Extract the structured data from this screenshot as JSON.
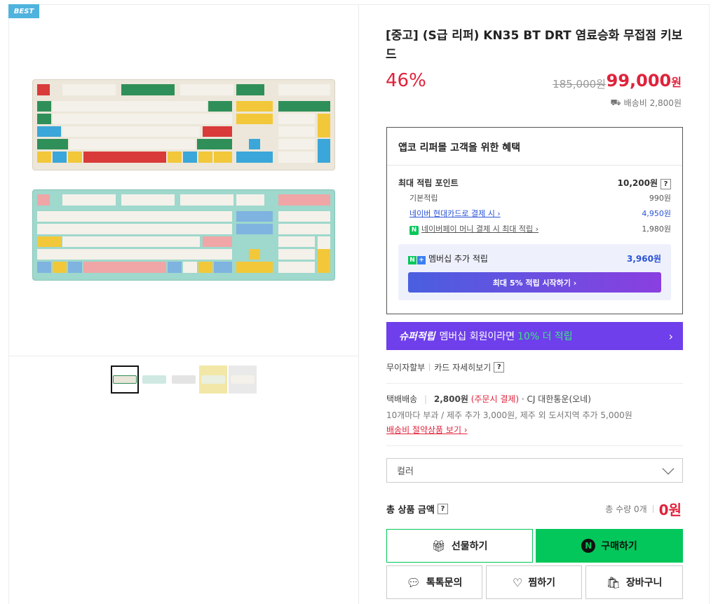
{
  "badge": "BEST",
  "thumbnails": [
    {
      "color": "#e9e5d8",
      "selected": true
    },
    {
      "color": "#cfe9e2",
      "selected": false
    },
    {
      "color": "#e4e4e4",
      "selected": false
    },
    {
      "color": "#f2e7a6",
      "selected": false
    },
    {
      "color": "#e9e9e9",
      "selected": false
    }
  ],
  "product": {
    "title": "[중고] (S급 리퍼) KN35 BT DRT 염료승화 무접점 키보드",
    "discount": "46%",
    "original_price": "185,000원",
    "price": "99,000",
    "price_unit": "원",
    "shipping_fee_note": "배송비 2,800원"
  },
  "benefit": {
    "header": "앱코 리퍼몰 고객을 위한 혜택",
    "max_points_label": "최대 적립 포인트",
    "max_points_value": "10,200원",
    "basic_label": "기본적립",
    "basic_value": "990원",
    "card_label": "네이버 현대카드로 결제 시 ›",
    "card_value": "4,950원",
    "npay_label": "네이버페이 머니 결제 시 최대 적립 ›",
    "npay_value": "1,980원",
    "membership_label": "멤버십 추가 적립",
    "membership_value": "3,960원",
    "membership_button": "최대 5% 적립 시작하기 ›"
  },
  "super_banner": {
    "brand": "슈퍼적립",
    "text": "멤버십 회원이라면",
    "highlight": "10% 더 적립",
    "arrow": "›"
  },
  "card_info": {
    "installment": "무이자할부",
    "card_detail": "카드 자세히보기"
  },
  "delivery": {
    "method": "택배배송",
    "fee": "2,800원",
    "payment_note": "(주문시 결제)",
    "carrier": "· CJ 대한통운(오네)",
    "extra": "10개마다 부과 / 제주 추가 3,000원, 제주 외 도서지역 추가 5,000원",
    "saving_link": "배송비 절약상품 보기 ›"
  },
  "option_select": {
    "placeholder": "컬러"
  },
  "total": {
    "label": "총 상품 금액",
    "qty": "총 수량 0개",
    "amount": "0원"
  },
  "buttons": {
    "gift": "선물하기",
    "buy": "구매하기",
    "talk": "톡톡문의",
    "wish": "찜하기",
    "cart": "장바구니"
  },
  "colors": {
    "accent_red": "#e0223b",
    "naver_green": "#03c75a",
    "super_purple": "#6e3fea"
  }
}
